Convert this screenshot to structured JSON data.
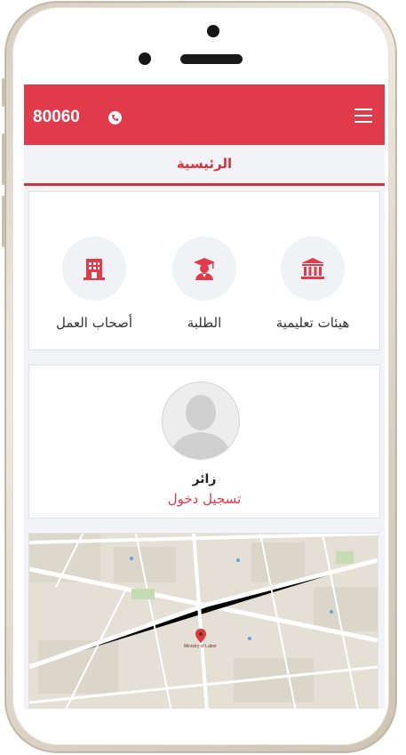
{
  "appbar": {
    "phone_number": "80060",
    "phone_icon": "phone-icon",
    "menu_icon": "hamburger-menu-icon",
    "color": "#e03a4b"
  },
  "titlebar": {
    "title": "الرئيسية"
  },
  "categories": [
    {
      "label": "أصحاب العمل",
      "icon": "building-icon"
    },
    {
      "label": "الطلبة",
      "icon": "graduate-icon"
    },
    {
      "label": "هيئات تعليمية",
      "icon": "institution-icon"
    }
  ],
  "profile": {
    "name": "زائر",
    "login_label": "تسجيل دخول",
    "avatar_icon": "user-avatar-icon"
  },
  "map": {
    "pin_label": "Ministry of Labor",
    "marker_icon": "map-pin-icon"
  },
  "colors": {
    "accent": "#e03a4b",
    "background": "#f2f3f6"
  }
}
